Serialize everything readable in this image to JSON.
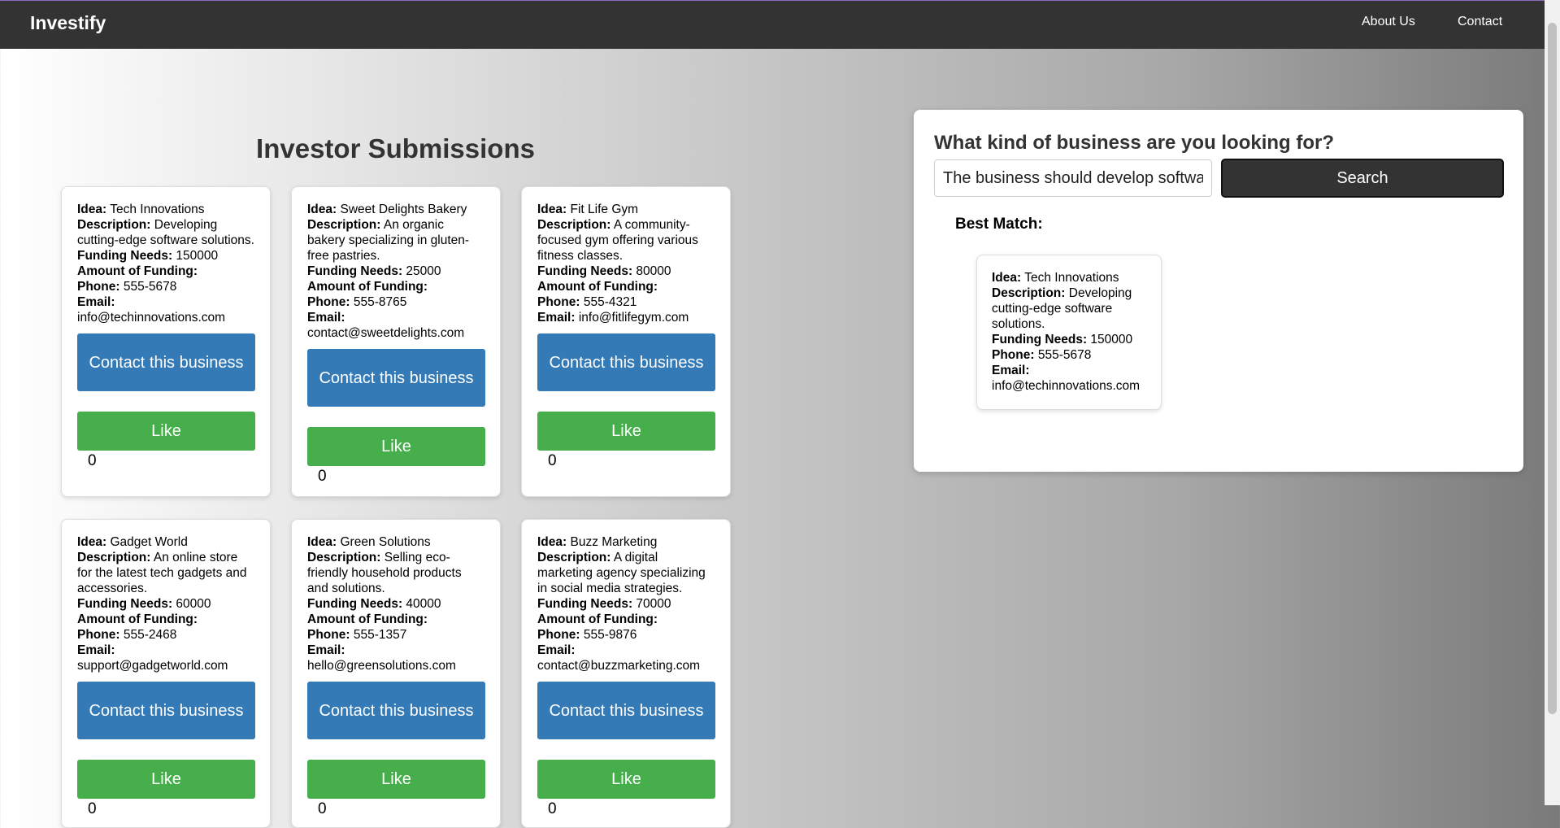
{
  "nav": {
    "brand": "Investify",
    "links": [
      "About Us",
      "Contact"
    ]
  },
  "main": {
    "heading": "Investor Submissions",
    "labels": {
      "idea": "Idea:",
      "description": "Description:",
      "funding_needs": "Funding Needs:",
      "amount_of_funding": "Amount of Funding:",
      "phone": "Phone:",
      "email": "Email:"
    },
    "contact_label": "Contact this business",
    "like_label": "Like",
    "cards": [
      {
        "idea": "Tech Innovations",
        "description": "Developing cutting-edge software solutions.",
        "funding_needs": "150000",
        "phone": "555-5678",
        "email": "info@techinnovations.com",
        "likes": "0"
      },
      {
        "idea": "Sweet Delights Bakery",
        "description": "An organic bakery specializing in gluten-free pastries.",
        "funding_needs": "25000",
        "phone": "555-8765",
        "email": "contact@sweetdelights.com",
        "likes": "0"
      },
      {
        "idea": "Fit Life Gym",
        "description": "A community-focused gym offering various fitness classes.",
        "funding_needs": "80000",
        "phone": "555-4321",
        "email": "info@fitlifegym.com",
        "likes": "0"
      },
      {
        "idea": "Gadget World",
        "description": "An online store for the latest tech gadgets and accessories.",
        "funding_needs": "60000",
        "phone": "555-2468",
        "email": "support@gadgetworld.com",
        "likes": "0"
      },
      {
        "idea": "Green Solutions",
        "description": "Selling eco-friendly household products and solutions.",
        "funding_needs": "40000",
        "phone": "555-1357",
        "email": "hello@greensolutions.com",
        "likes": "0"
      },
      {
        "idea": "Buzz Marketing",
        "description": "A digital marketing agency specializing in social media strategies.",
        "funding_needs": "70000",
        "phone": "555-9876",
        "email": "contact@buzzmarketing.com",
        "likes": "0"
      }
    ]
  },
  "search": {
    "title": "What kind of business are you looking for?",
    "input_value": "The business should develop software",
    "button_label": "Search",
    "best_match_label": "Best Match:",
    "best_match": {
      "idea": "Tech Innovations",
      "description": "Developing cutting-edge software solutions.",
      "funding_needs": "150000",
      "phone": "555-5678",
      "email": "info@techinnovations.com"
    }
  }
}
